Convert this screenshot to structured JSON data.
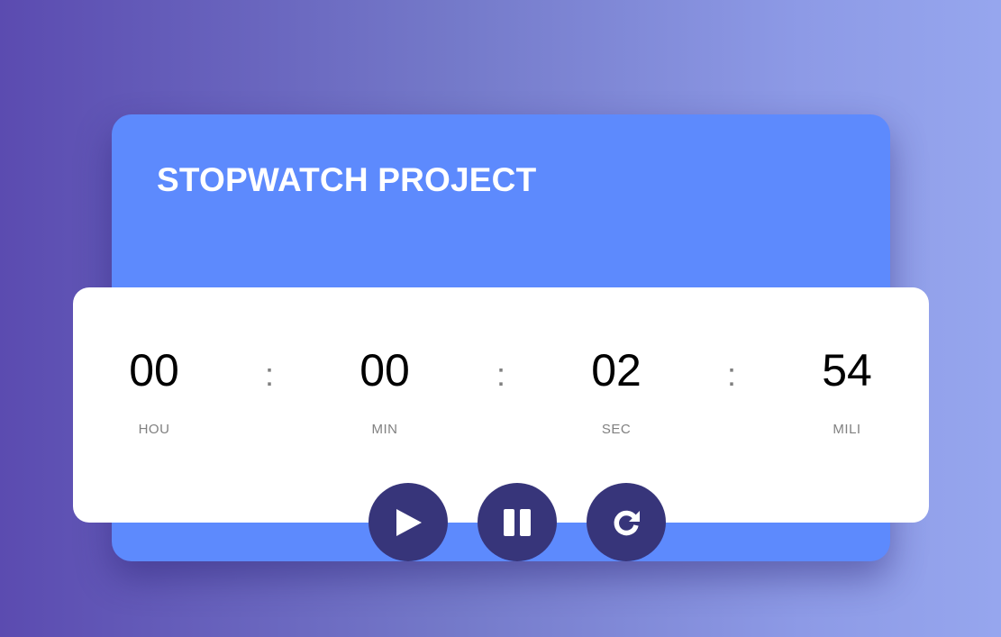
{
  "app": {
    "title": "STOPWATCH PROJECT"
  },
  "timer": {
    "hours": "00",
    "minutes": "00",
    "seconds": "02",
    "millis": "54",
    "separator": ":",
    "labels": {
      "hours": "HOU",
      "minutes": "MIN",
      "seconds": "SEC",
      "millis": "MILI"
    }
  },
  "controls": {
    "start_icon": "play-icon",
    "pause_icon": "pause-icon",
    "reset_icon": "reset-icon"
  },
  "colors": {
    "card": "#5d8afd",
    "panel": "#ffffff",
    "button": "#37357a",
    "digits": "#000000",
    "labels": "#808080"
  }
}
